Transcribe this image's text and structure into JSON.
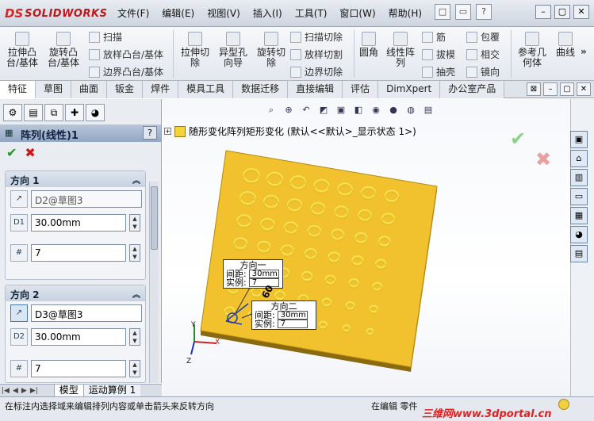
{
  "app": {
    "logo_prefix": "DS",
    "logo_name": "SOLIDWORKS"
  },
  "menu": [
    "文件(F)",
    "编辑(E)",
    "视图(V)",
    "插入(I)",
    "工具(T)",
    "窗口(W)",
    "帮助(H)"
  ],
  "ribbon": {
    "big_buttons": [
      {
        "label": "拉伸凸\n台/基体"
      },
      {
        "label": "旋转凸\n台/基体"
      },
      {
        "label": "拉伸切\n除"
      },
      {
        "label": "异型孔\n向导"
      },
      {
        "label": "旋转切\n除"
      },
      {
        "label": "圆角"
      },
      {
        "label": "线性阵\n列"
      },
      {
        "label": "参考几\n何体"
      },
      {
        "label": "曲线"
      }
    ],
    "small_buttons": [
      {
        "label": "扫描",
        "enabled": true
      },
      {
        "label": "放样凸台/基体",
        "enabled": true
      },
      {
        "label": "边界凸台/基体",
        "enabled": true
      },
      {
        "label": "扫描切除",
        "enabled": true
      },
      {
        "label": "放样切割",
        "enabled": true
      },
      {
        "label": "边界切除",
        "enabled": true
      },
      {
        "label": "筋",
        "enabled": true
      },
      {
        "label": "拔模",
        "enabled": true
      },
      {
        "label": "抽壳",
        "enabled": true
      },
      {
        "label": "包覆",
        "enabled": true
      },
      {
        "label": "相交",
        "enabled": true
      },
      {
        "label": "镜向",
        "enabled": true
      }
    ],
    "more_indicator": "»"
  },
  "tabs": [
    {
      "label": "特征",
      "active": true
    },
    {
      "label": "草图",
      "active": false
    },
    {
      "label": "曲面",
      "active": false
    },
    {
      "label": "钣金",
      "active": false
    },
    {
      "label": "焊件",
      "active": false
    },
    {
      "label": "模具工具",
      "active": false
    },
    {
      "label": "数据迁移",
      "active": false
    },
    {
      "label": "直接编辑",
      "active": false
    },
    {
      "label": "评估",
      "active": false
    },
    {
      "label": "DimXpert",
      "active": false
    },
    {
      "label": "办公室产品",
      "active": false
    }
  ],
  "property_manager": {
    "title": "阵列(线性)1",
    "help": "?",
    "direction1": {
      "header": "方向 1",
      "reference": "D2@草图3",
      "spacing": "30.00mm",
      "instances": "7"
    },
    "direction2": {
      "header": "方向 2",
      "reference": "D3@草图3",
      "spacing": "30.00mm",
      "instances": "7"
    }
  },
  "bottom_tabs": [
    {
      "label": "模型",
      "active": true
    },
    {
      "label": "运动算例 1",
      "active": false
    }
  ],
  "viewport": {
    "tree_text": "随形变化阵列矩形变化  (默认<<默认>_显示状态 1>)",
    "callout1": {
      "title": "方向一",
      "spacing_label": "间距:",
      "spacing_value": "30mm",
      "count_label": "实例:",
      "count_value": "7"
    },
    "callout2": {
      "title": "方向二",
      "spacing_label": "间距:",
      "spacing_value": "30mm",
      "count_label": "实例:",
      "count_value": "7"
    },
    "dim_label": "60",
    "plate_color": "#f2c12e",
    "hole_color": "#f6e85a",
    "triad_labels": [
      "Y",
      "X",
      "Z"
    ]
  },
  "status": {
    "left_text": "在标注内选择域来编辑排列内容或单击箭头来反转方向",
    "mode_text": "在编辑 零件",
    "watermark": "三维网www.3dportal.cn"
  }
}
